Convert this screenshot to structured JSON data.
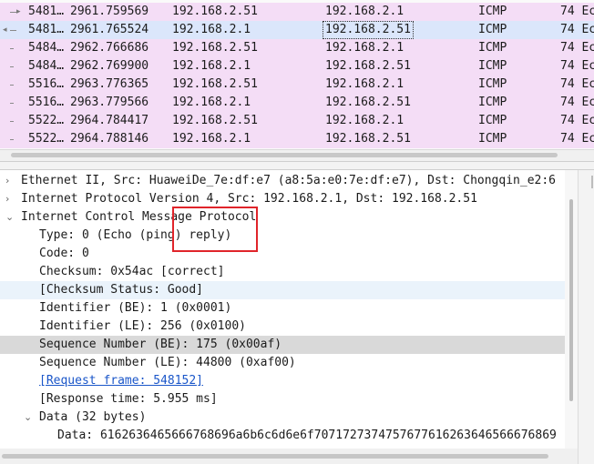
{
  "packet_list": {
    "rows": [
      {
        "no": "5481…",
        "time": "2961.759569",
        "src": "192.168.2.51",
        "dst": "192.168.2.1",
        "proto": "ICMP",
        "info": "74 Ec",
        "selected": false
      },
      {
        "no": "5481…",
        "time": "2961.765524",
        "src": "192.168.2.1",
        "dst": "192.168.2.51",
        "proto": "ICMP",
        "info": "74 Ec",
        "selected": true
      },
      {
        "no": "5484…",
        "time": "2962.766686",
        "src": "192.168.2.51",
        "dst": "192.168.2.1",
        "proto": "ICMP",
        "info": "74 Ec",
        "selected": false
      },
      {
        "no": "5484…",
        "time": "2962.769900",
        "src": "192.168.2.1",
        "dst": "192.168.2.51",
        "proto": "ICMP",
        "info": "74 Ec",
        "selected": false
      },
      {
        "no": "5516…",
        "time": "2963.776365",
        "src": "192.168.2.51",
        "dst": "192.168.2.1",
        "proto": "ICMP",
        "info": "74 Ec",
        "selected": false
      },
      {
        "no": "5516…",
        "time": "2963.779566",
        "src": "192.168.2.1",
        "dst": "192.168.2.51",
        "proto": "ICMP",
        "info": "74 Ec",
        "selected": false
      },
      {
        "no": "5522…",
        "time": "2964.784417",
        "src": "192.168.2.51",
        "dst": "192.168.2.1",
        "proto": "ICMP",
        "info": "74 Ec",
        "selected": false
      },
      {
        "no": "5522…",
        "time": "2964.788146",
        "src": "192.168.2.1",
        "dst": "192.168.2.51",
        "proto": "ICMP",
        "info": "74 Ec",
        "selected": false
      }
    ]
  },
  "details": {
    "ethernet": "Ethernet II, Src: HuaweiDe_7e:df:e7 (a8:5a:e0:7e:df:e7), Dst: Chongqin_e2:6",
    "ip": "Internet Protocol Version 4, Src: 192.168.2.1, Dst: 192.168.2.51",
    "icmp": "Internet Control Message Protocol",
    "type": "Type: 0 (Echo (ping) reply)",
    "code": "Code: 0",
    "checksum": "Checksum: 0x54ac [correct]",
    "checksum_status": "[Checksum Status: Good]",
    "identifier_be": "Identifier (BE): 1 (0x0001)",
    "identifier_le": "Identifier (LE): 256 (0x0100)",
    "seq_be": "Sequence Number (BE): 175 (0x00af)",
    "seq_le": "Sequence Number (LE): 44800 (0xaf00)",
    "request_frame": "[Request frame: 548152]",
    "response_time": "[Response time: 5.955 ms]",
    "data_header": "Data (32 bytes)",
    "data_value": "Data: 6162636465666768696a6b6c6d6e6f7071727374757677616263646566676869"
  },
  "colors": {
    "icmp_row": "#f4ddf6",
    "selected_row": "#dbe6fb",
    "annotation": "#e0242a",
    "link": "#1a56c9"
  },
  "icons": {
    "collapsed": "chevron-right-icon",
    "expanded": "chevron-down-icon"
  }
}
